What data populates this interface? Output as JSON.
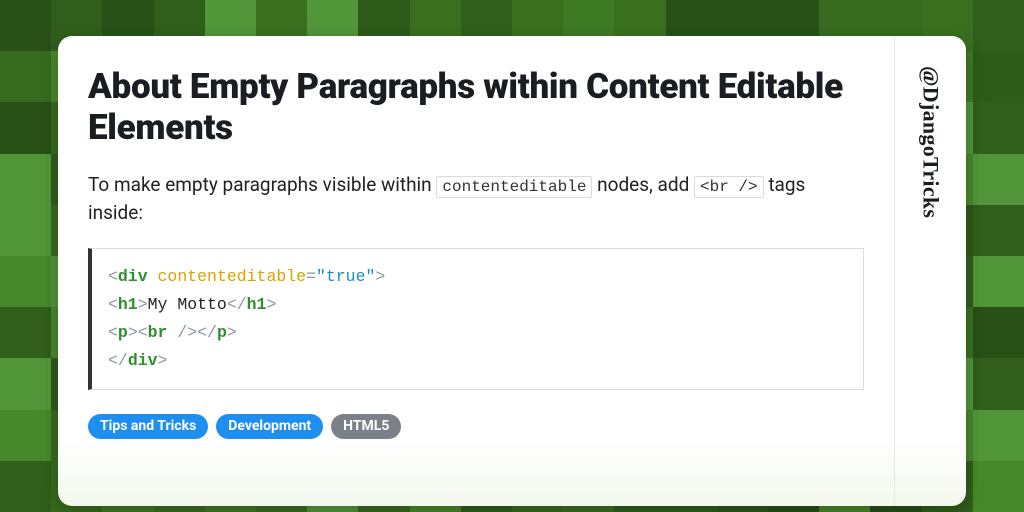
{
  "title": "About Empty Paragraphs within Content Editable Elements",
  "desc_pre": "To make empty paragraphs visible within ",
  "desc_code1": "contenteditable",
  "desc_mid": " nodes, add ",
  "desc_code2": "<br />",
  "desc_post": " tags inside:",
  "code": {
    "l1_open": "<",
    "l1_tag": "div",
    "l1_sp": " ",
    "l1_attr": "contenteditable",
    "l1_eq": "=",
    "l1_val": "\"true\"",
    "l1_close": ">",
    "l2_open": "<",
    "l2_tag": "h1",
    "l2_close1": ">",
    "l2_text": "My Motto",
    "l2_open2": "</",
    "l2_close2": ">",
    "l3_open": "<",
    "l3_tag_p": "p",
    "l3_close1": ">",
    "l3_open2": "<",
    "l3_tag_br": "br",
    "l3_selfclose": " />",
    "l3_open3": "</",
    "l3_close3": ">",
    "l4_open": "</",
    "l4_tag": "div",
    "l4_close": ">"
  },
  "tags": [
    "Tips and Tricks",
    "Development",
    "HTML5"
  ],
  "tag_styles": [
    "tag-blue",
    "tag-blue",
    "tag-grey"
  ],
  "handle": "@DjangoTricks",
  "bg_shades": [
    "#2e5a1a",
    "#376b1f",
    "#3f7a24",
    "#47892a",
    "#52963a",
    "#3a6f20",
    "#315f1b",
    "#285017"
  ]
}
